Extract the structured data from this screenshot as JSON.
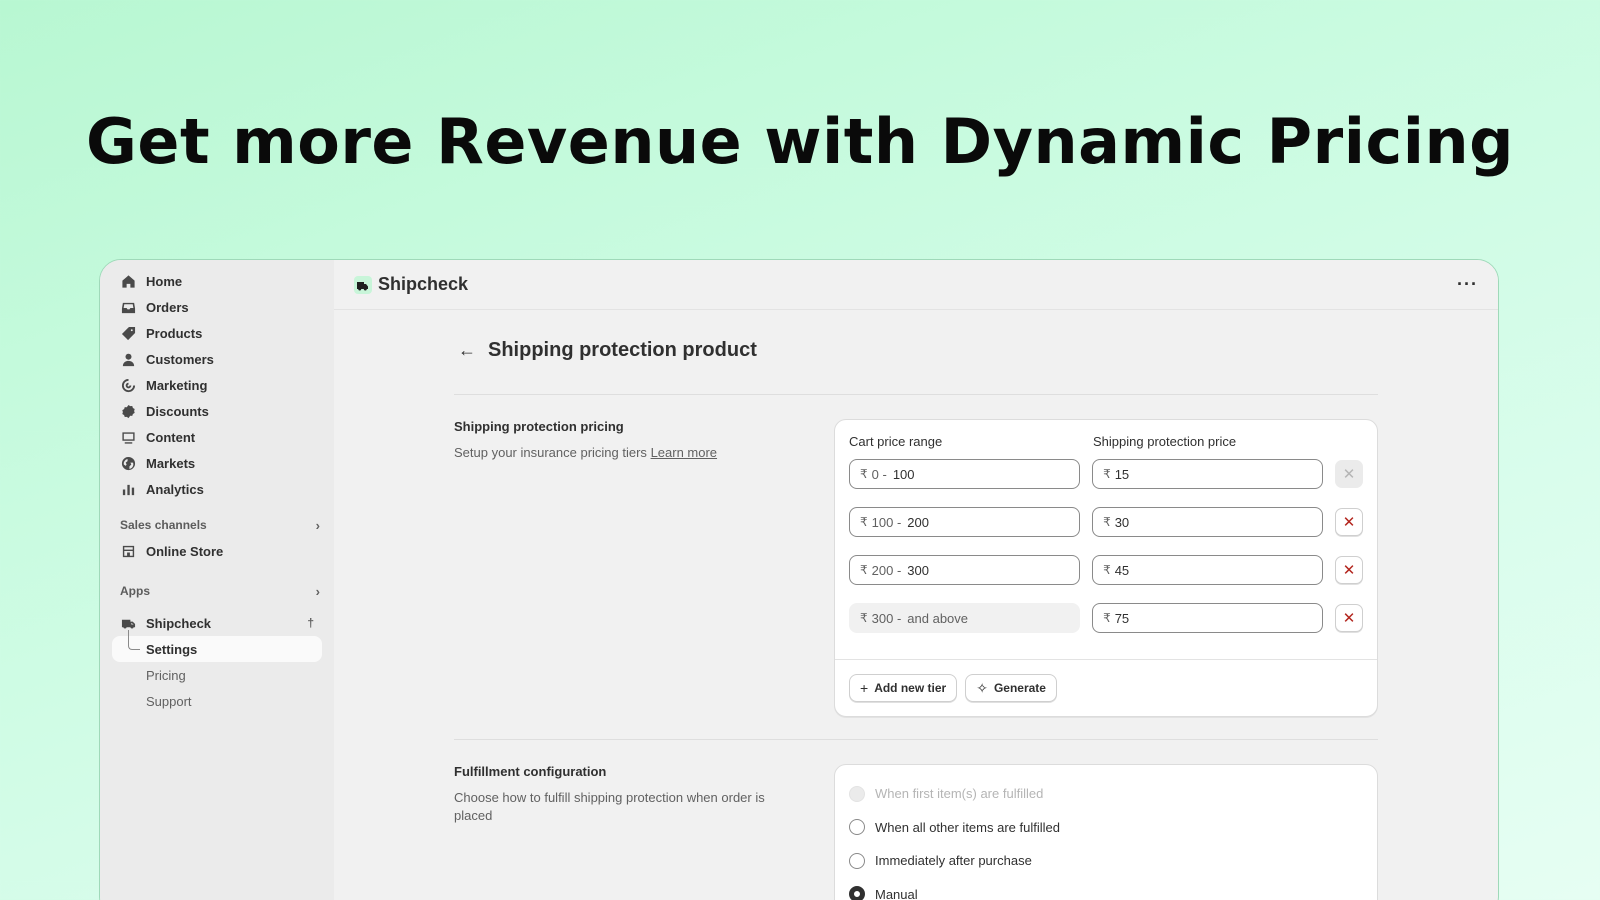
{
  "hero": {
    "title": "Get more Revenue with Dynamic Pricing"
  },
  "sidebar": {
    "items": [
      {
        "label": "Home",
        "icon": "home-icon"
      },
      {
        "label": "Orders",
        "icon": "orders-icon"
      },
      {
        "label": "Products",
        "icon": "tag-icon"
      },
      {
        "label": "Customers",
        "icon": "person-icon"
      },
      {
        "label": "Marketing",
        "icon": "target-icon"
      },
      {
        "label": "Discounts",
        "icon": "discount-icon"
      },
      {
        "label": "Content",
        "icon": "content-icon"
      },
      {
        "label": "Markets",
        "icon": "globe-icon"
      },
      {
        "label": "Analytics",
        "icon": "bar-chart-icon"
      }
    ],
    "sales_channels": {
      "label": "Sales channels",
      "online_store": "Online Store"
    },
    "apps": {
      "label": "Apps",
      "app_name": "Shipcheck",
      "sub_items": [
        "Settings",
        "Pricing",
        "Support"
      ],
      "active_sub": "Settings"
    }
  },
  "topbar": {
    "app_name": "Shipcheck",
    "more": "···"
  },
  "page": {
    "title": "Shipping protection product"
  },
  "pricing": {
    "title": "Shipping protection pricing",
    "description": "Setup your insurance pricing tiers",
    "learn_more": "Learn more",
    "col_range": "Cart price range",
    "col_price": "Shipping protection price",
    "currency": "₹",
    "tiers": [
      {
        "low": "0 -",
        "high": "100",
        "price": "15"
      },
      {
        "low": "100 -",
        "high": "200",
        "price": "30"
      },
      {
        "low": "200 -",
        "high": "300",
        "price": "45"
      },
      {
        "low": "300 -",
        "high": "and above",
        "price": "75"
      }
    ],
    "add_tier": "Add new tier",
    "generate": "Generate"
  },
  "fulfillment": {
    "title": "Fulfillment configuration",
    "description": "Choose how to fulfill shipping protection when order is placed",
    "options": [
      "When first item(s) are fulfilled",
      "When all other items are fulfilled",
      "Immediately after purchase",
      "Manual"
    ],
    "selected": "Manual"
  },
  "colors": {
    "accent": "#303030",
    "delete": "#b3261e",
    "brand_bg": "#b8f7d2"
  }
}
